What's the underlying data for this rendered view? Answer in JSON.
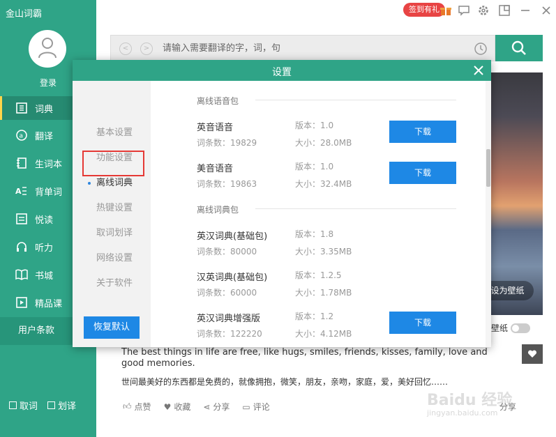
{
  "app": {
    "title": "金山词霸"
  },
  "sidebar": {
    "login_label": "登录",
    "items": [
      {
        "label": "词典",
        "icon": "dictionary-icon",
        "active": true
      },
      {
        "label": "翻译",
        "icon": "translate-icon"
      },
      {
        "label": "生词本",
        "icon": "wordbook-icon"
      },
      {
        "label": "背单词",
        "icon": "memorize-icon"
      },
      {
        "label": "悦读",
        "icon": "reading-icon"
      },
      {
        "label": "听力",
        "icon": "headphones-icon"
      },
      {
        "label": "书城",
        "icon": "bookstore-icon"
      },
      {
        "label": "精品课",
        "icon": "course-icon"
      }
    ],
    "terms_label": "用户条款",
    "checkbox_1": "取词",
    "checkbox_2": "划译"
  },
  "topbar": {
    "promo_label": "签到有礼"
  },
  "search": {
    "placeholder": "请输入需要翻译的字，词，句"
  },
  "main": {
    "set_wallpaper_label": "设为壁纸",
    "wallpaper_toggle_label": "壁纸",
    "quote_en": "The best things in life are free, like hugs, smiles, friends, kisses, family, love and good memories.",
    "quote_cn": "世间最美好的东西都是免费的，就像拥抱，微笑，朋友，亲吻，家庭，爱，美好回忆……",
    "actions": {
      "like": "点赞",
      "favorite": "收藏",
      "share": "分享",
      "comment": "评论"
    },
    "share_right": "分享",
    "watermark": "Baidu 经验",
    "watermark_url": "jingyan.baidu.com"
  },
  "dialog": {
    "title": "设置",
    "nav": [
      "基本设置",
      "功能设置",
      "离线词典",
      "热键设置",
      "取词划译",
      "网络设置",
      "关于软件"
    ],
    "active_nav": "离线词典",
    "restore_label": "恢复默认",
    "voice_section": "离线语音包",
    "dict_section": "离线词典包",
    "download_label": "下载",
    "packages": [
      {
        "name": "英音语音",
        "count": "词条数：19829",
        "version": "版本：1.0",
        "size": "大小：28.0MB",
        "download": true
      },
      {
        "name": "美音语音",
        "count": "词条数：19863",
        "version": "版本：1.0",
        "size": "大小：32.4MB",
        "download": true
      },
      {
        "name": "英汉词典(基础包)",
        "count": "词条数：80000",
        "version": "版本：1.8",
        "size": "大小：3.35MB",
        "download": false
      },
      {
        "name": "汉英词典(基础包)",
        "count": "词条数：60000",
        "version": "版本：1.2.5",
        "size": "大小：1.78MB",
        "download": false
      },
      {
        "name": "英汉词典增强版",
        "count": "词条数：122220",
        "version": "版本：1.2",
        "size": "大小：4.12MB",
        "download": true
      }
    ]
  },
  "colors": {
    "brand": "#2fa487",
    "button_blue": "#1e88e5",
    "highlight_red": "#e53935"
  }
}
